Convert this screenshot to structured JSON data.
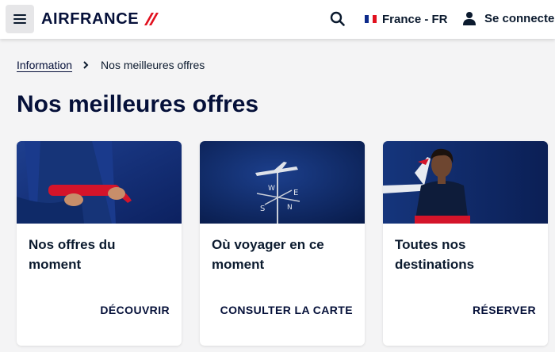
{
  "header": {
    "menu_icon": "hamburger-icon",
    "logo_text": "AIRFRANCE",
    "logo_mark_color": "#e1101e",
    "search_icon": "search-icon",
    "country_label": "France - FR",
    "flag_colors": [
      "#0d2a8a",
      "#ffffff",
      "#e1101e"
    ],
    "login_icon": "user-icon",
    "login_label": "Se connecter"
  },
  "breadcrumb": {
    "link_label": "Information",
    "separator_icon": "chevron-right-icon",
    "current_label": "Nos meilleures offres"
  },
  "page_title": "Nos meilleures offres",
  "cards": [
    {
      "title": "Nos offres du moment",
      "cta": "DÉCOUVRIR",
      "image": "woman-blue-dress-red-ribbon"
    },
    {
      "title": "Où voyager en ce moment",
      "cta": "CONSULTER LA CARTE",
      "image": "weathervane-airplane"
    },
    {
      "title": "Toutes nos destinations",
      "cta": "RÉSERVER",
      "image": "flight-attendant-airplane"
    }
  ],
  "colors": {
    "brand_navy": "#051039",
    "accent_red": "#e1101e",
    "background": "#f4f4f5"
  }
}
